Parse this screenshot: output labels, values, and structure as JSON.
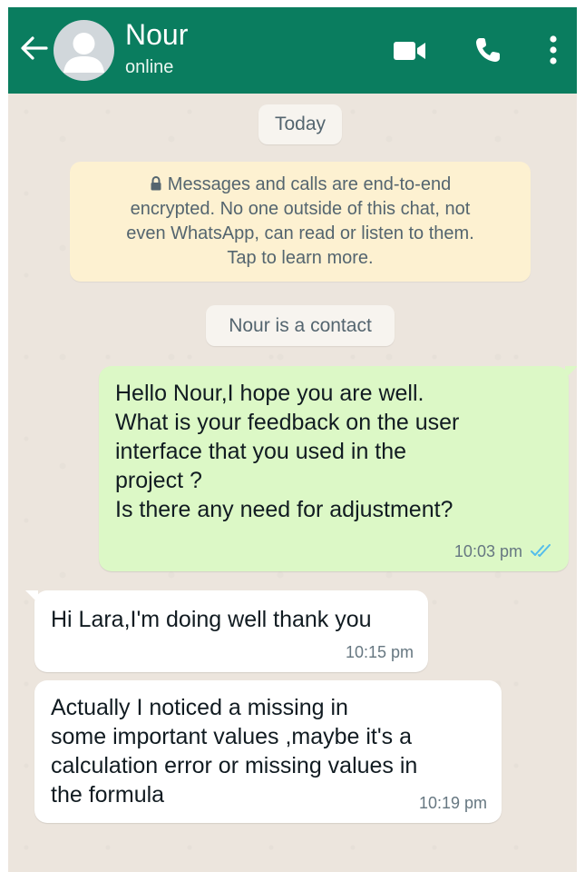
{
  "header": {
    "contact_name": "Nour",
    "status": "online",
    "colors": {
      "bar": "#0a7d5f",
      "text": "#ffffff"
    },
    "icons": [
      "back-arrow-icon",
      "video-call-icon",
      "voice-call-icon",
      "more-options-icon"
    ]
  },
  "chat": {
    "date_label": "Today",
    "encryption_notice": "Messages and calls are end-to-end\nencrypted. No one outside of this chat, not\neven WhatsApp, can read or listen to them.\nTap to learn more.",
    "contact_label": "Nour is a contact",
    "messages": [
      {
        "direction": "outgoing",
        "text": "Hello Nour,I hope you are well.\nWhat is your feedback on the user\ninterface that you used in the\nproject ?\nIs there any need for adjustment?",
        "time": "10:03 pm",
        "status": "read"
      },
      {
        "direction": "incoming",
        "text": "Hi Lara,I'm doing well thank you",
        "time": "10:15 pm"
      },
      {
        "direction": "incoming",
        "text": "Actually I noticed a missing  in\nsome  important values ,maybe it's a\ncalculation error or missing values in\nthe formula",
        "time": "10:19 pm"
      }
    ],
    "colors": {
      "background": "#ece5dd",
      "outgoing_bubble": "#dcf8c6",
      "incoming_bubble": "#ffffff",
      "notice_bubble": "#fdf1d1",
      "read_ticks": "#53bdeb"
    }
  }
}
